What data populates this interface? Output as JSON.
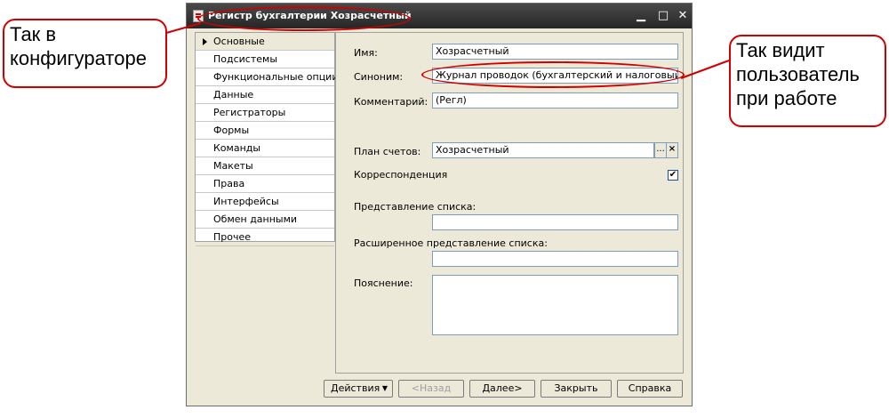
{
  "window": {
    "title": "Регистр бухгалтерии Хозрасчетный",
    "icons": {
      "minimize": "minimize-icon",
      "maximize": "maximize-icon",
      "close": "close-icon"
    }
  },
  "nav": {
    "items": [
      {
        "label": "Основные",
        "active": true
      },
      {
        "label": "Подсистемы"
      },
      {
        "label": "Функциональные опции"
      },
      {
        "label": "Данные"
      },
      {
        "label": "Регистраторы"
      },
      {
        "label": "Формы"
      },
      {
        "label": "Команды"
      },
      {
        "label": "Макеты"
      },
      {
        "label": "Права"
      },
      {
        "label": "Интерфейсы"
      },
      {
        "label": "Обмен данными"
      },
      {
        "label": "Прочее"
      }
    ]
  },
  "form": {
    "name_label": "Имя:",
    "name_value": "Хозрасчетный",
    "synonym_label": "Синоним:",
    "synonym_value": "Журнал проводок (бухгалтерский и налоговый учет)",
    "comment_label": "Комментарий:",
    "comment_value": "(Регл)",
    "chart_label": "План счетов:",
    "chart_value": "Хозрасчетный",
    "chart_select_btn": "...",
    "chart_clear_btn": "×",
    "correspondence_label": "Корреспонденция",
    "correspondence_checked": true,
    "list_repr_label": "Представление списка:",
    "list_repr_value": "",
    "ext_list_repr_label": "Расширенное представление списка:",
    "ext_list_repr_value": "",
    "explanation_label": "Пояснение:",
    "explanation_value": ""
  },
  "buttons": {
    "actions": "Действия",
    "back": "<Назад",
    "next": "Далее>",
    "close": "Закрыть",
    "help": "Справка"
  },
  "callouts": {
    "configurator": "Так в конфигураторе",
    "user": "Так видит пользователь при работе"
  },
  "colors": {
    "accent": "#d00000",
    "titlebar": "#333333",
    "window_bg": "#ece9d8"
  }
}
